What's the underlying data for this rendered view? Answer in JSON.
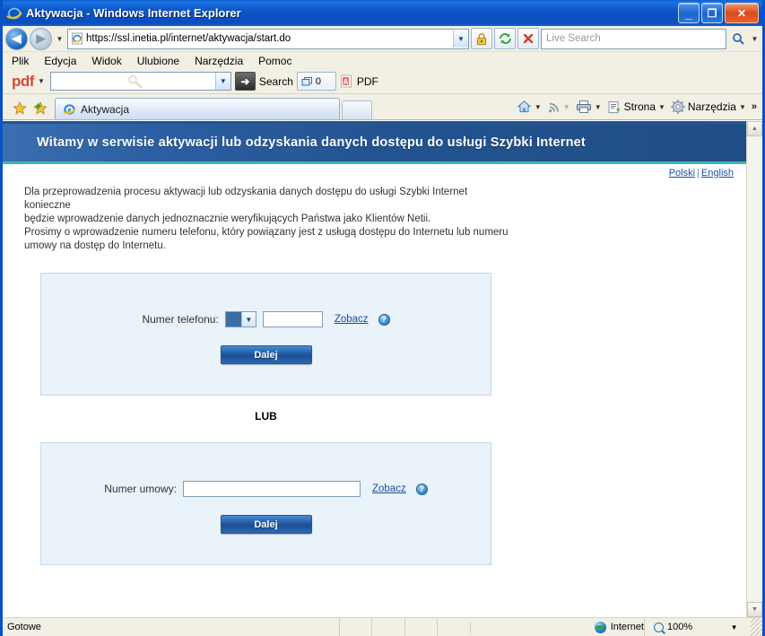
{
  "window": {
    "title_page": "Aktywacja",
    "title_app": " - Windows Internet Explorer",
    "minimize_label": "_",
    "maximize_label": "❐",
    "close_label": "✕"
  },
  "address_bar": {
    "back_label": "◀",
    "forward_label": "▶",
    "history_caret": "▼",
    "url": "https://ssl.inetia.pl/internet/aktywacja/start.do",
    "url_dropdown_caret": "▼",
    "search_placeholder": "Live Search",
    "search_caret": "▼",
    "icons": {
      "padlock": "padlock-icon",
      "refresh": "refresh-icon",
      "stop": "stop-icon",
      "search": "search-icon"
    }
  },
  "menubar": {
    "items": [
      {
        "label": "Plik",
        "accel": "P"
      },
      {
        "label": "Edycja",
        "accel": "E"
      },
      {
        "label": "Widok",
        "accel": "W"
      },
      {
        "label": "Ulubione",
        "accel": "U"
      },
      {
        "label": "Narzędzia",
        "accel": "N"
      },
      {
        "label": "Pomoc",
        "accel": "c"
      }
    ]
  },
  "pdf_toolbar": {
    "logo": "pdf",
    "logo_caret": "▼",
    "input_value": "",
    "input_caret": "▼",
    "go_label": "➜",
    "search_label": "Search",
    "count": "0",
    "pdf_label": "PDF"
  },
  "tabbar": {
    "favorites_icon": "star-icon",
    "add_favorite_icon": "star-plus-icon",
    "tab_title": "Aktywacja",
    "new_tab_label": "",
    "commands": [
      {
        "name": "home",
        "label": "",
        "caret": "▼"
      },
      {
        "name": "feeds",
        "label": "",
        "caret": "▼"
      },
      {
        "name": "print",
        "label": "",
        "caret": "▼"
      },
      {
        "name": "page",
        "label": "Strona",
        "caret": "▼"
      },
      {
        "name": "tools",
        "label": "Narzędzia",
        "caret": "▼"
      }
    ],
    "overflow_label": "»"
  },
  "page": {
    "banner_title": "Witamy w serwisie aktywacji lub odzyskania danych dostępu do usługi Szybki Internet",
    "lang_polski": "Polski",
    "lang_separator": "|",
    "lang_english": "English",
    "intro_line1": "Dla przeprowadzenia procesu aktywacji lub odzyskania danych dostępu do usługi Szybki Internet konieczne",
    "intro_line2": "będzie wprowadzenie danych jednoznacznie weryfikujących Państwa jako Klientów Netii.",
    "intro_line3": "Prosimy o wprowadzenie numeru telefonu, który powiązany jest z usługą dostępu do Internetu lub numeru",
    "intro_line4": "umowy na dostęp do Internetu.",
    "divider_label": "LUB",
    "phone_panel": {
      "label": "Numer telefonu:",
      "prefix_selected": "",
      "prefix_caret": "▼",
      "number_value": "",
      "help_link": "Zobacz",
      "help_icon_label": "?",
      "submit_label": "Dalej"
    },
    "contract_panel": {
      "label": "Numer umowy:",
      "value": "",
      "help_link": "Zobacz",
      "help_icon_label": "?",
      "submit_label": "Dalej"
    },
    "scroll_up": "▲",
    "scroll_down": "▼"
  },
  "statusbar": {
    "status": "Gotowe",
    "zone": "Internet",
    "zoom": "100%",
    "zoom_caret": "▼"
  },
  "colors": {
    "title_blue": "#0b4dbd",
    "banner_blue": "#23538f",
    "accent_teal": "#3fb8ac",
    "panel_bg": "#eaf2fa",
    "link_blue": "#1a4f9c",
    "button_blue": "#1b4f96"
  }
}
